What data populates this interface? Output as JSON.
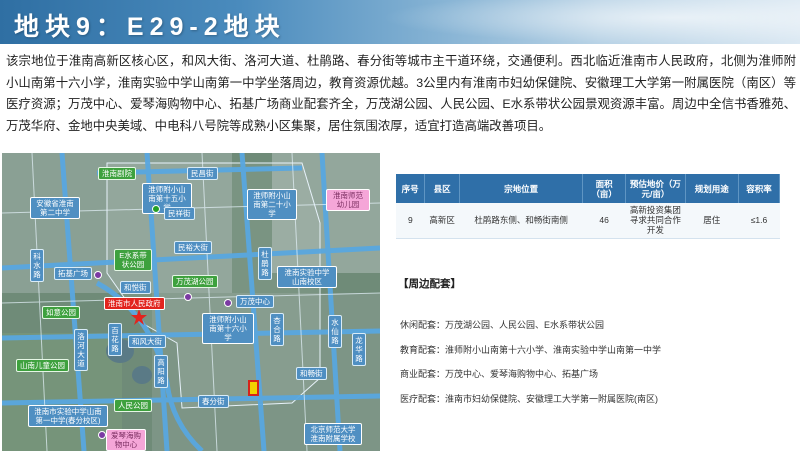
{
  "header": {
    "title": "地块9：E29-2地块"
  },
  "intro": "该宗地位于淮南高新区核心区，和风大街、洛河大道、杜鹃路、春分街等城市主干道环绕，交通便利。西北临近淮南市人民政府，北侧为淮师附小山南第十六小学，淮南实验中学山南第一中学坐落周边，教育资源优越。3公里内有淮南市妇幼保健院、安徽理工大学第一附属医院（南区）等医疗资源；万茂中心、爱琴海购物中心、拓基广场商业配套齐全，万茂湖公园、人民公园、E水系带状公园景观资源丰富。周边中全信书香雅苑、万茂华府、金地中央美域、中电科八号院等成熟小区集聚，居住氛围浓厚，适宜打造高端改善项目。",
  "map": {
    "roads": [
      "淮南剧院",
      "民昌街",
      "民祥街",
      "民裕大街",
      "拓基广场",
      "和悦街",
      "和风大街",
      "高阳路",
      "春分街",
      "和畅街",
      "杜鹃路",
      "杏合路",
      "北仙路",
      "洛河大道",
      "水仙路",
      "龙霞路",
      "科水路",
      "百花路",
      "大杏路",
      "龙华路"
    ],
    "schools": [
      "安徽省淮南第二中学",
      "淮师附小山南第十五小学",
      "淮师附小山南第二十小学",
      "淮师附小山南第十六小学",
      "淮南实验中学山南校区",
      "淮南实验中学山南第一中学",
      "淮南市实验中学山南第一中学(春分校区)",
      "北京师范大学淮南附属学校"
    ],
    "parks": [
      "E水系带状公园",
      "万茂湖公园",
      "如意公园",
      "山南儿童公园",
      "人民公园"
    ],
    "others": [
      "淮南市人民政府",
      "万茂中心",
      "爱琴海购物中心",
      "淮南师范幼儿园"
    ]
  },
  "table": {
    "headers": [
      "序号",
      "县区",
      "宗地位置",
      "面积（亩）",
      "预估地价（万元/亩）",
      "规划用途",
      "容积率"
    ],
    "row": [
      "9",
      "高新区",
      "杜鹃路东侧、和畅街南侧",
      "46",
      "高新投资集团寻求共同合作开发",
      "居住",
      "≤1.6"
    ]
  },
  "support": {
    "title": "【周边配套】",
    "leisure": "休闲配套：万茂湖公园、人民公园、E水系带状公园",
    "education": "教育配套：淮师附小山南第十六小学、淮南实验中学山南第一中学",
    "commerce": "商业配套：万茂中心、爱琴海购物中心、拓基广场",
    "medical": "医疗配套：淮南市妇幼保健院、安徽理工大学第一附属医院(南区)"
  },
  "colors": {
    "header": "#2f6fa3",
    "road_label": "#4f8fc2",
    "park_label": "#3ea13e",
    "gov_label": "#e2241e",
    "table_header": "#2f6fa8"
  }
}
